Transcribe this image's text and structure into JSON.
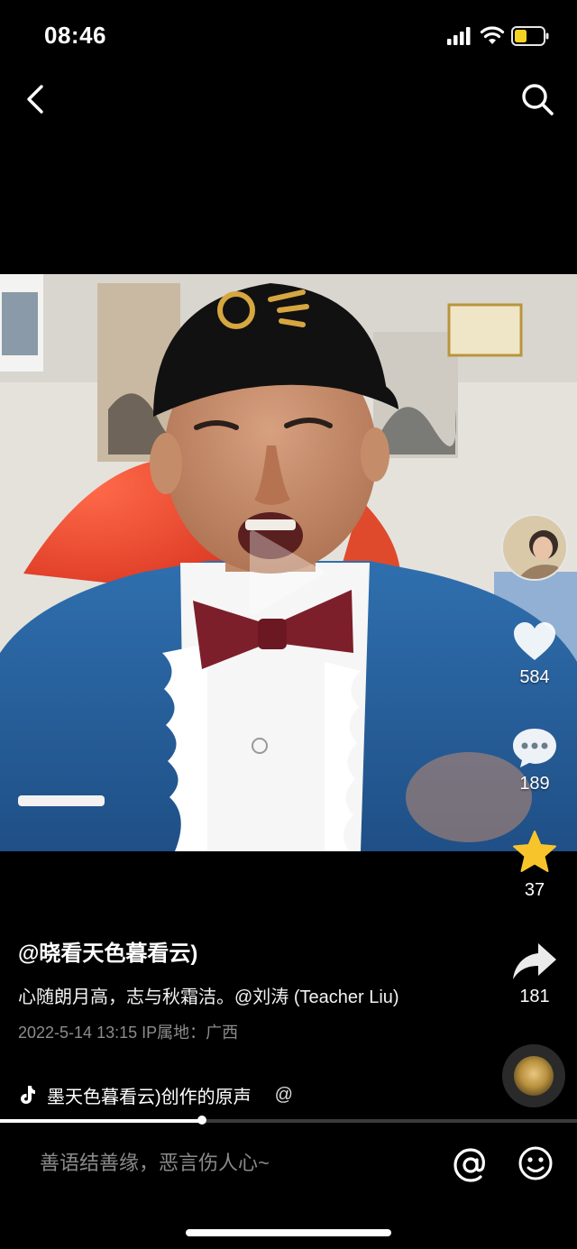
{
  "status_bar": {
    "time": "08:46",
    "icons": [
      "signal-icon",
      "wifi-icon",
      "battery-icon"
    ],
    "battery_color": "#F5D323"
  },
  "nav": {
    "icons": [
      "back-icon",
      "search-icon"
    ]
  },
  "video": {
    "playback_progress": 0.35
  },
  "actions": {
    "likes": "584",
    "comments": "189",
    "favorites": "37",
    "shares": "181",
    "favorite_color": "#F7C52B"
  },
  "caption": {
    "author": "@晓看天色暮看云)",
    "description": "心随朗月高，志与秋霜洁。@刘涛 (Teacher Liu)",
    "meta": "2022-5-14 13:15  IP属地：广西"
  },
  "music": {
    "title": "墨天色暮看云)创作的原声",
    "at": "@"
  },
  "comment_bar": {
    "placeholder": "善语结善缘，恶言伤人心~",
    "icons": [
      "at-icon",
      "emoji-icon"
    ]
  }
}
